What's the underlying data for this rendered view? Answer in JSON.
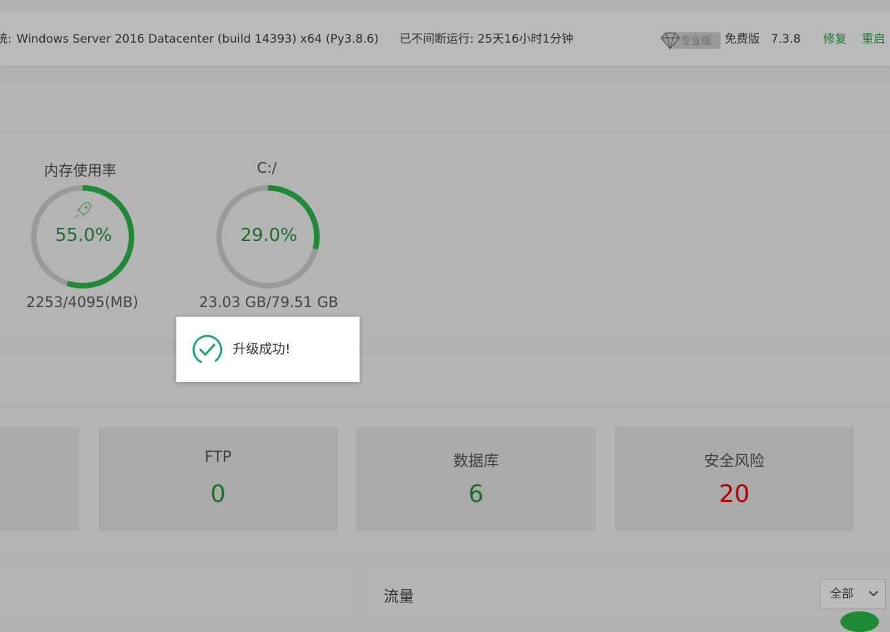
{
  "header": {
    "system_label": "统:",
    "system_text": "Windows Server 2016 Datacenter (build 14393) x64 (Py3.8.6)",
    "uptime": "已不间断运行: 25天16小时1分钟",
    "pro_badge": "专业版",
    "edition": "免费版",
    "version": "7.3.8",
    "fix_label": "修复",
    "restart_label": "重启"
  },
  "status": {
    "memory": {
      "title": "内存使用率",
      "percent_text": "55.0%",
      "percent": 55.0,
      "detail": "2253/4095(MB)"
    },
    "disk": {
      "title": "C:/",
      "percent_text": "29.0%",
      "percent": 29.0,
      "detail": "23.03 GB/79.51 GB"
    }
  },
  "overview": {
    "cards": [
      {
        "label": "FTP",
        "value": "0"
      },
      {
        "label": "数据库",
        "value": "6"
      },
      {
        "label": "安全风险",
        "value": "20"
      }
    ]
  },
  "traffic": {
    "title": "流量",
    "select_value": "全部"
  },
  "toast": {
    "message": "升级成功!"
  },
  "colors": {
    "accent_green": "#1d6e2b",
    "danger_red": "#b10000",
    "gauge_track": "#9a9a9a",
    "toast_icon": "#1aa67a"
  }
}
